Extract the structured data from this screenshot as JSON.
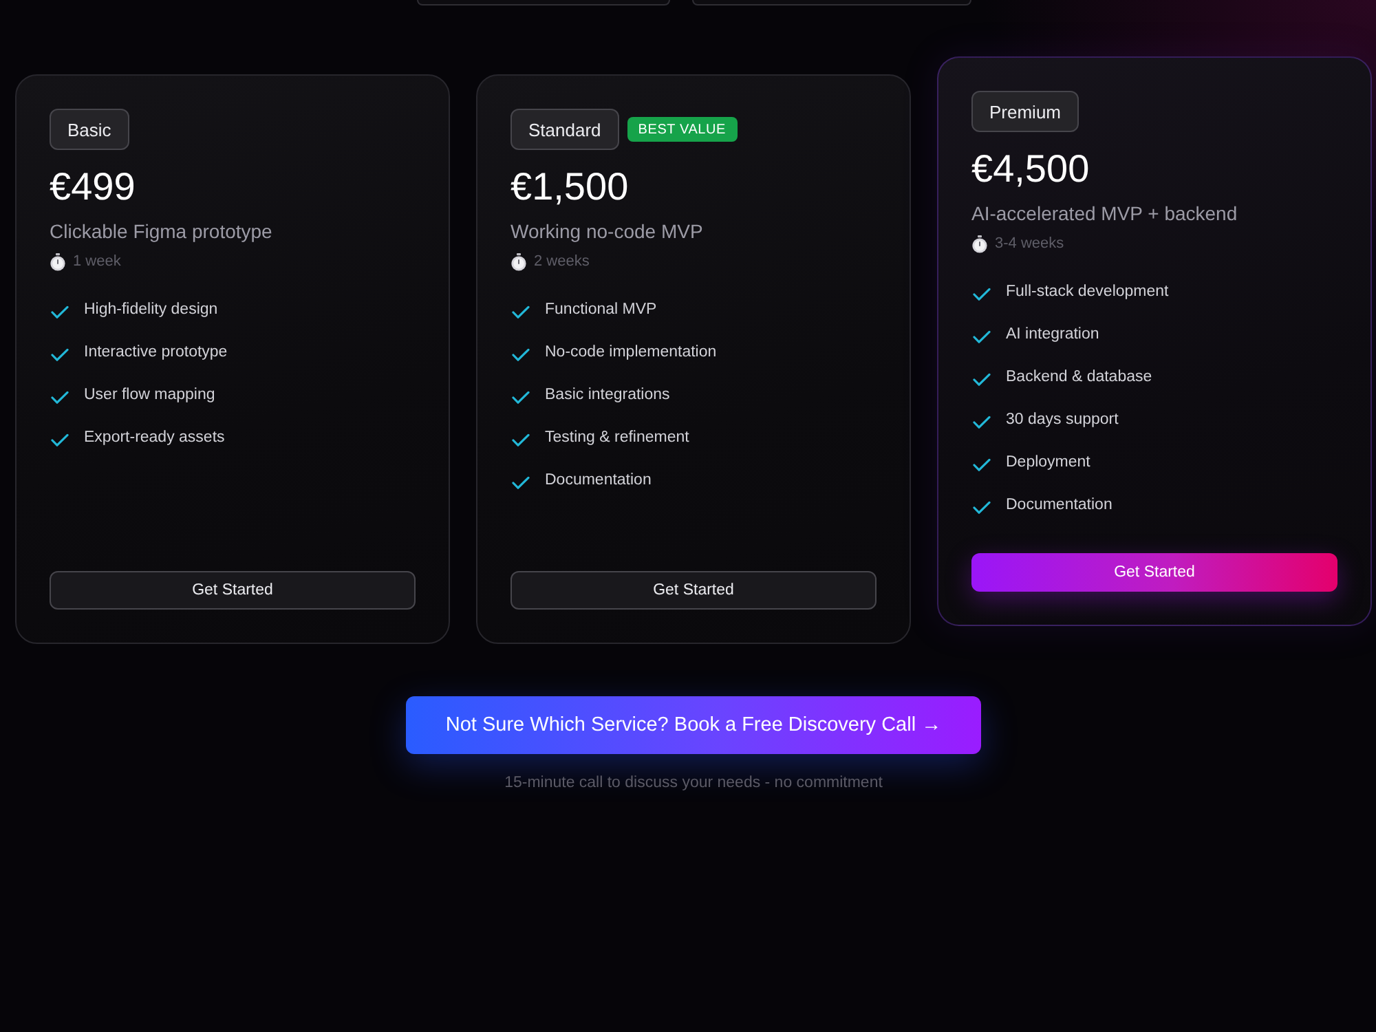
{
  "top_buttons": [
    {
      "kind": "outline"
    },
    {
      "kind": "outline"
    }
  ],
  "plans": [
    {
      "name": "Basic",
      "price": "€499",
      "subtitle": "Clickable Figma prototype",
      "duration": "1 week",
      "features": [
        "High-fidelity design",
        "Interactive prototype",
        "User flow mapping",
        "Export-ready assets"
      ],
      "button": "Get Started",
      "featured": false
    },
    {
      "name": "Standard",
      "badge": "BEST VALUE",
      "price": "€1,500",
      "subtitle": "Working no-code MVP",
      "duration": "2 weeks",
      "features": [
        "Functional MVP",
        "No-code implementation",
        "Basic integrations",
        "Testing & refinement",
        "Documentation"
      ],
      "button": "Get Started",
      "featured": false
    },
    {
      "name": "Premium",
      "price": "€4,500",
      "subtitle": "AI-accelerated MVP + backend",
      "duration": "3-4 weeks",
      "features": [
        "Full-stack development",
        "AI integration",
        "Backend & database",
        "30 days support",
        "Deployment",
        "Documentation"
      ],
      "button": "Get Started",
      "featured": true
    }
  ],
  "cta": {
    "button": "Not Sure Which Service? Book a Free Discovery Call →",
    "note": "15-minute call to discuss your needs - no commitment"
  }
}
